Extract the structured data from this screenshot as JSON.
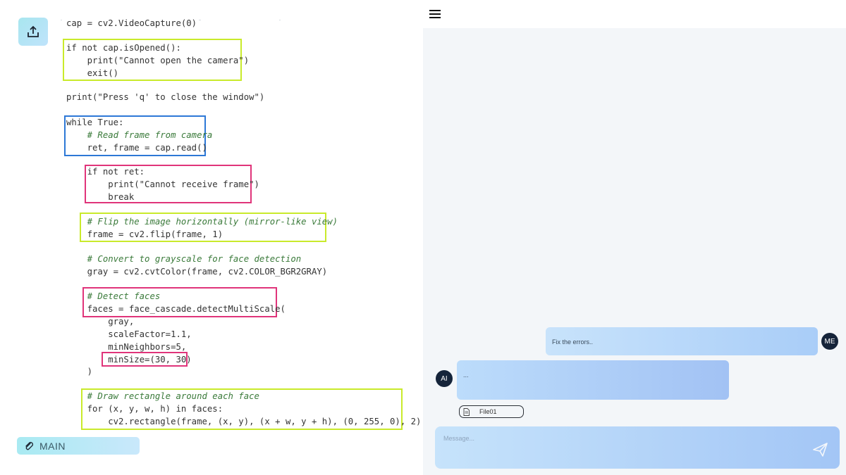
{
  "left_panel": {
    "upload_icon": "upload-icon",
    "code_lines": [
      "cap = cv2.VideoCapture(0)",
      "if not cap.isOpened():",
      "    print(\"Cannot open the camera\")",
      "    exit()",
      "print(\"Press 'q' to close the window\")",
      "while True:",
      "    # Read frame from camera",
      "    ret, frame = cap.read()",
      "    if not ret:",
      "        print(\"Cannot receive frame\")",
      "        break",
      "    # Flip the image horizontally (mirror-like view)",
      "    frame = cv2.flip(frame, 1)",
      "    # Convert to grayscale for face detection",
      "    gray = cv2.cvtColor(frame, cv2.COLOR_BGR2GRAY)",
      "    # Detect faces",
      "    faces = face_cascade.detectMultiScale(",
      "        gray,",
      "        scaleFactor=1.1,",
      "        minNeighbors=5,",
      "        minSize=(30, 30)",
      "    )",
      "    # Draw rectangle around each face",
      "    for (x, y, w, h) in faces:",
      "        cv2.rectangle(frame, (x, y), (x + w, y + h), (0, 255, 0), 2)"
    ],
    "main_label": "MAIN",
    "main_icon": "paperclip-icon"
  },
  "right_panel": {
    "menu_icon": "hamburger-menu-icon",
    "user_avatar": "ME",
    "user_message": "Fix the errors..",
    "ai_avatar": "AI",
    "ai_message": "...",
    "attachment": {
      "icon": "file-icon",
      "label": "File01"
    },
    "message_placeholder": "Message...",
    "send_icon": "send-icon"
  },
  "colors": {
    "highlight_yellow": "#c9ea2b",
    "highlight_blue": "#2d78d6",
    "highlight_pink": "#e0347a",
    "avatar_bg": "#15243a"
  }
}
